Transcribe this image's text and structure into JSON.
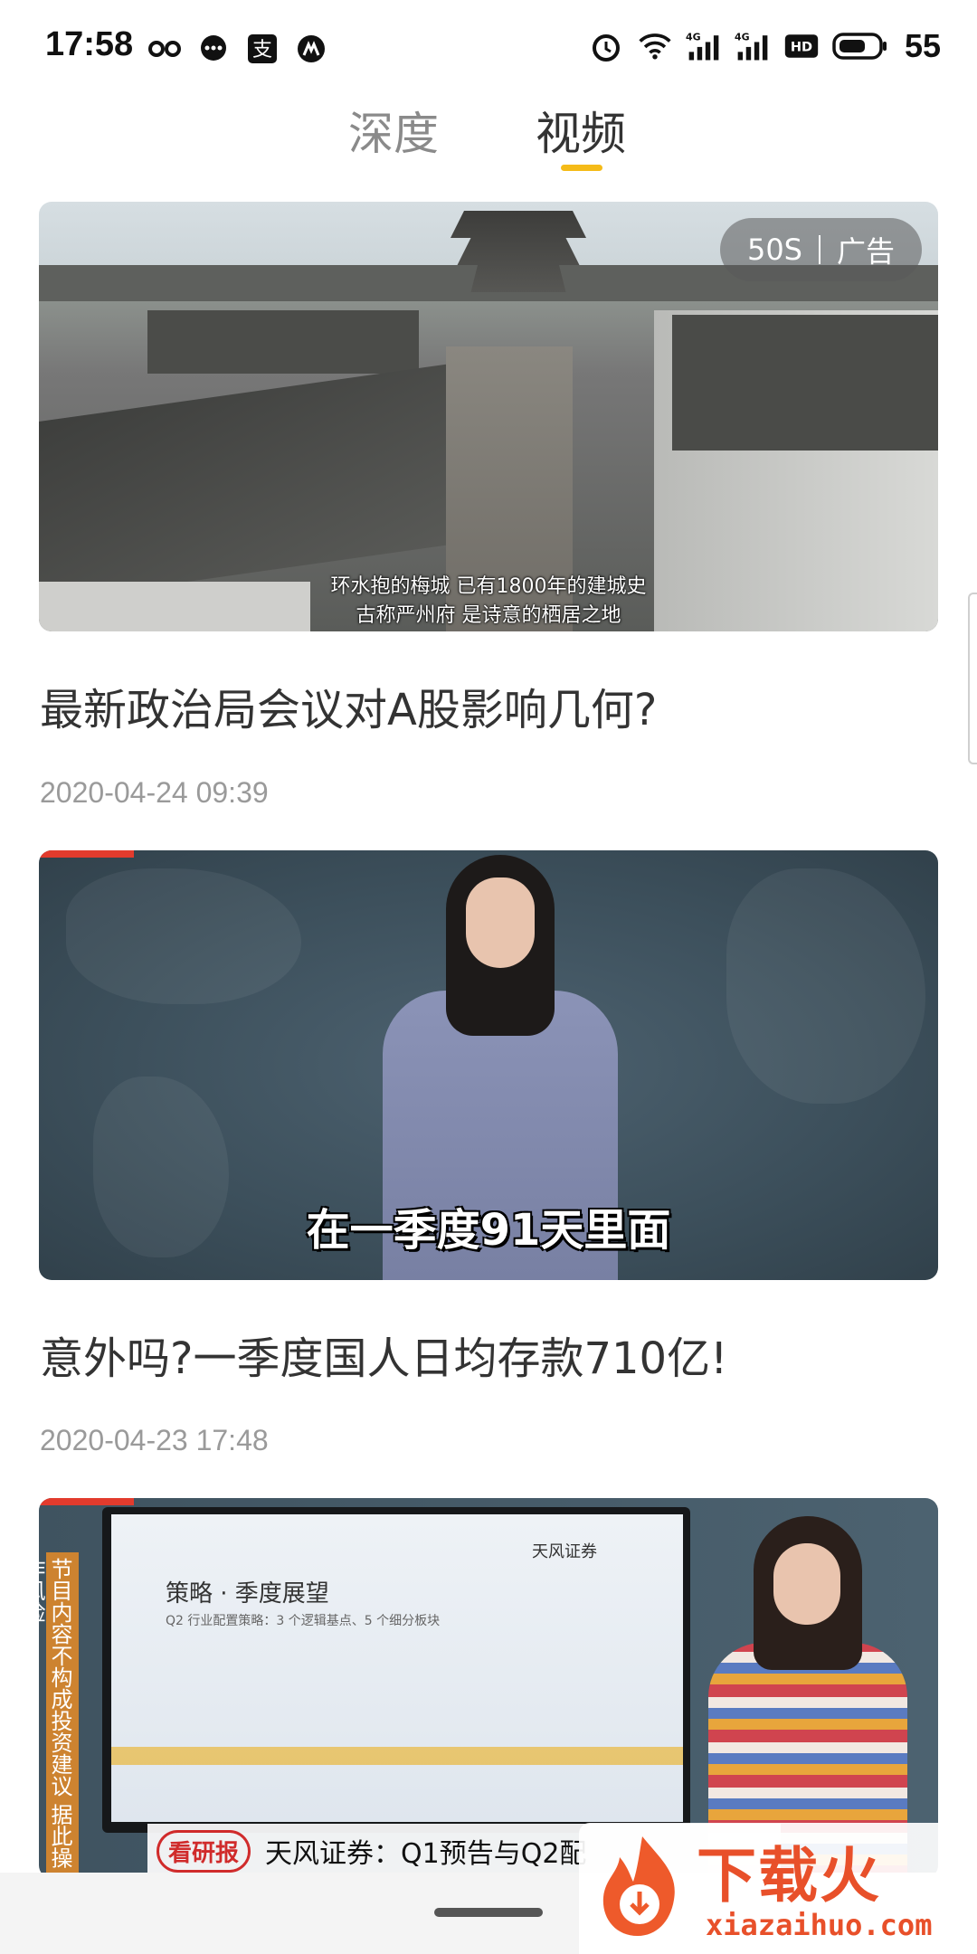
{
  "status_bar": {
    "time": "17:58",
    "battery": "55",
    "icons_left": [
      "infinity-icon",
      "message-icon",
      "alipay-icon",
      "app-icon"
    ],
    "icons_right": [
      "alarm-icon",
      "wifi-icon",
      "signal-4g-icon",
      "signal-4g-icon",
      "hd-icon",
      "battery-icon"
    ]
  },
  "tabs": [
    {
      "label": "深度",
      "active": false
    },
    {
      "label": "视频",
      "active": true
    }
  ],
  "accent_color": "#f5bb18",
  "feed": [
    {
      "ad_duration": "50S",
      "ad_label": "广告",
      "subtitle_line1": "环水抱的梅城 已有1800年的建城史",
      "subtitle_line2": "古称严州府 是诗意的栖居之地",
      "title": "最新政治局会议对A股影响几何?",
      "date": "2020-04-24 09:39"
    },
    {
      "caption": "在一季度91天里面",
      "title": "意外吗?一季度国人日均存款710亿!",
      "date": "2020-04-23 17:48"
    },
    {
      "doc_heading": "策略 · 季度展望",
      "doc_sub": "Q2 行业配置策略：3 个逻辑基点、5 个细分板块",
      "doc_brand": "天风证券",
      "side_text": "节目内容不构成投资建议 据此操作风险",
      "badge": "看研报",
      "bottom_title": "天风证券：Q1预告与Q2配"
    }
  ],
  "watermark": {
    "title": "下载火",
    "url": "xiazaihuo.com"
  }
}
